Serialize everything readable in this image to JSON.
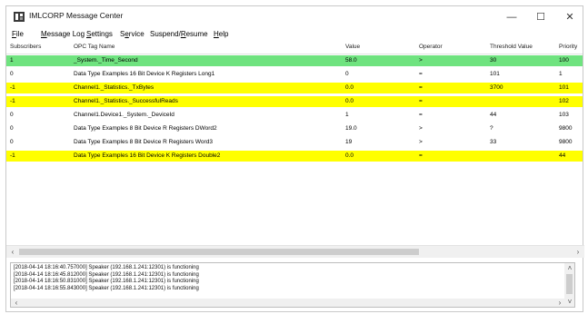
{
  "window": {
    "title": "IMLCORP Message Center"
  },
  "window_controls": {
    "minimize": "—",
    "maximize": "☐",
    "close": "✕"
  },
  "menu": [
    "File",
    "Message Log",
    "Settings",
    "Service",
    "Suspend/Resume",
    "Help"
  ],
  "menu_underline": [
    "F",
    "M",
    "S",
    "e",
    "R",
    "H"
  ],
  "columns": [
    "Subscribers",
    "OPC Tag Name",
    "Value",
    "Operator",
    "Threshold Value",
    "Priority"
  ],
  "colors": {
    "green": "#6fe37f",
    "yellow": "#ffff00",
    "white": "#ffffff"
  },
  "rows": [
    {
      "subscribers": "1",
      "tag": "_System._Time_Second",
      "value": "58.0",
      "operator": ">",
      "threshold": "30",
      "priority": "100",
      "color": "green"
    },
    {
      "subscribers": "0",
      "tag": "Data Type Examples 16 Bit Device K Registers Long1",
      "value": "0",
      "operator": "=",
      "threshold": "101",
      "priority": "1",
      "color": "white"
    },
    {
      "subscribers": "-1",
      "tag": "Channel1._Statistics._TxBytes",
      "value": "0.0",
      "operator": "=",
      "threshold": "3700",
      "priority": "101",
      "color": "yellow"
    },
    {
      "subscribers": "-1",
      "tag": "Channel1._Statistics._SuccessfulReads",
      "value": "0.0",
      "operator": "=",
      "threshold": "",
      "priority": "102",
      "color": "yellow"
    },
    {
      "subscribers": "0",
      "tag": "Channel1.Device1._System._DeviceId",
      "value": "1",
      "operator": "=",
      "threshold": "44",
      "priority": "103",
      "color": "white"
    },
    {
      "subscribers": "0",
      "tag": "Data Type Examples 8 Bit Device R Registers DWord2",
      "value": "19.0",
      "operator": ">",
      "threshold": "?",
      "priority": "9800",
      "color": "white"
    },
    {
      "subscribers": "0",
      "tag": "Data Type Examples 8 Bit Device R Registers Word3",
      "value": "19",
      "operator": ">",
      "threshold": "33",
      "priority": "9800",
      "color": "white"
    },
    {
      "subscribers": "-1",
      "tag": "Data Type Examples 16 Bit Device K Registers Double2",
      "value": "0.0",
      "operator": "=",
      "threshold": "",
      "priority": "44",
      "color": "yellow"
    }
  ],
  "log": [
    "[2018-04-14 18:16:40.757000]  Speaker (192.168.1.241:12301) is functioning",
    "[2018-04-14 18:16:45.812000]  Speaker (192.168.1.241:12301) is functioning",
    "[2018-04-14 18:16:50.831000]  Speaker (192.168.1.241:12301) is functioning",
    "[2018-04-14 18:16:55.843000]  Speaker (192.168.1.241:12301) is functioning"
  ],
  "scroll": {
    "left": "‹",
    "right": "›",
    "up": "˄",
    "down": "˅"
  }
}
